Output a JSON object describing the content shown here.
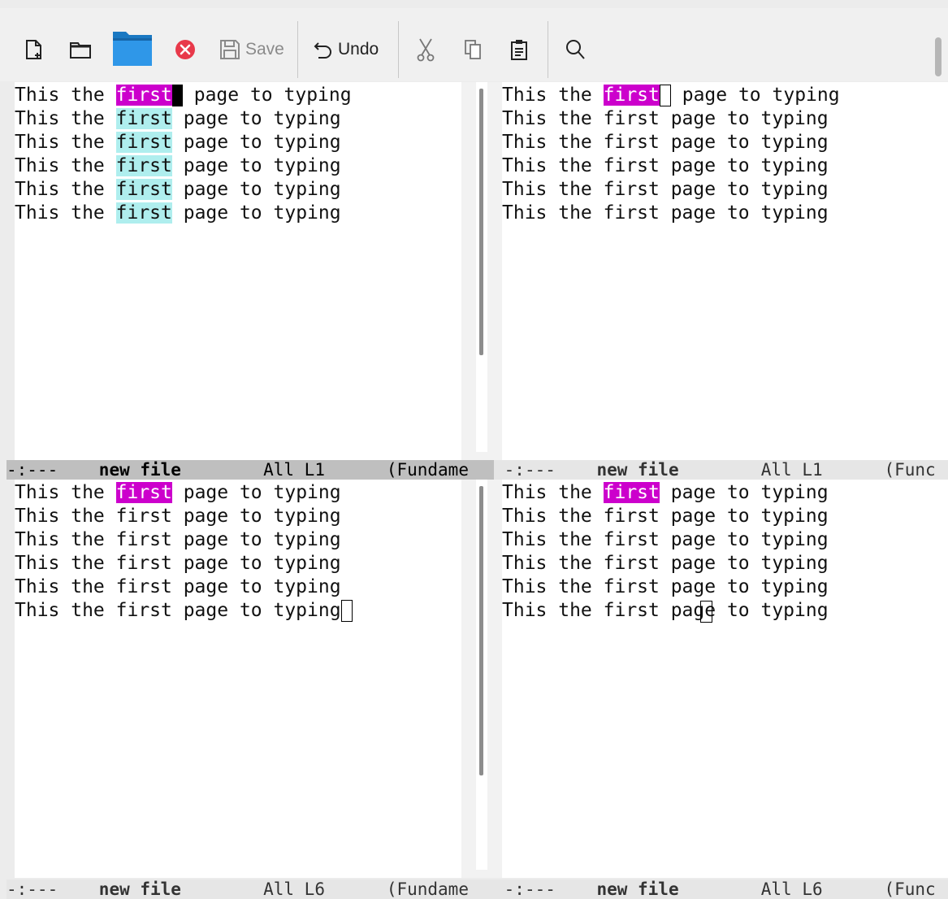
{
  "toolbar": {
    "save_label": "Save",
    "undo_label": "Undo",
    "icons": [
      "new-file-icon",
      "open-folder-icon",
      "dired-folder-icon",
      "close-buffer-icon",
      "save-icon",
      "undo-icon",
      "cut-icon",
      "copy-icon",
      "paste-icon",
      "search-icon"
    ]
  },
  "colors": {
    "isearch_match": "#cc00cc",
    "lazy_highlight": "#afeeee",
    "modeline_active": "#bfbfbf",
    "modeline_inactive": "#e6e6e6"
  },
  "buffer": {
    "line_text": "This the first page to typing",
    "lines": [
      "This the ",
      "first",
      " page to typing"
    ]
  },
  "windows": {
    "top_left": {
      "modeline": {
        "status": "-:---",
        "name": "new file",
        "pos": "All L1",
        "mode": "(Fundame"
      }
    },
    "top_right": {
      "modeline": {
        "status": "-:---",
        "name": "new file",
        "pos": "All L1",
        "mode": "(Func"
      }
    },
    "bottom_left": {
      "modeline": {
        "status": "-:---",
        "name": "new file",
        "pos": "All L6",
        "mode": "(Fundame"
      }
    },
    "bottom_right": {
      "modeline": {
        "status": "-:---",
        "name": "new file",
        "pos": "All L6",
        "mode": "(Func"
      }
    }
  }
}
